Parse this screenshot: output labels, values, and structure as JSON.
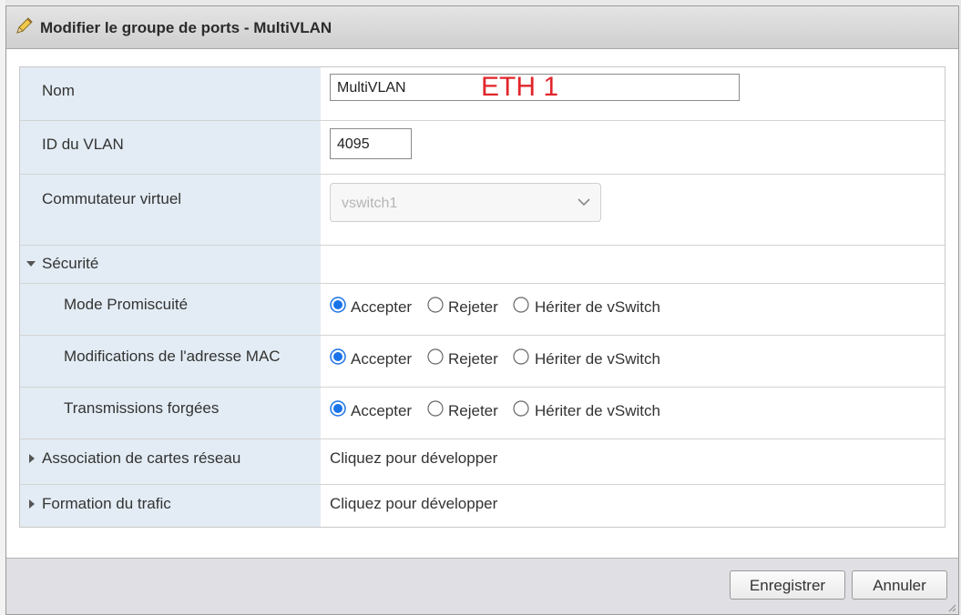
{
  "dialog": {
    "title": "Modifier le groupe de ports - MultiVLAN",
    "title_icon": "pencil-icon"
  },
  "fields": {
    "name_label": "Nom",
    "name_value": "MultiVLAN",
    "annotation": "ETH 1",
    "vlan_label": "ID du VLAN",
    "vlan_value": "4095",
    "vswitch_label": "Commutateur virtuel",
    "vswitch_value": "vswitch1"
  },
  "security": {
    "label": "Sécurité",
    "options": [
      "Accepter",
      "Rejeter",
      "Hériter de vSwitch"
    ],
    "rows": [
      {
        "label": "Mode Promiscuité",
        "selected": "Accepter"
      },
      {
        "label": "Modifications de l'adresse MAC",
        "selected": "Accepter"
      },
      {
        "label": "Transmissions forgées",
        "selected": "Accepter"
      }
    ]
  },
  "collapsed": [
    {
      "label": "Association de cartes réseau",
      "value": "Cliquez pour développer"
    },
    {
      "label": "Formation du trafic",
      "value": "Cliquez pour développer"
    }
  ],
  "footer": {
    "save_label": "Enregistrer",
    "cancel_label": "Annuler"
  },
  "colors": {
    "label_bg": "#e3ecf4",
    "radio_selected": "#1a73e8",
    "annotation": "#e0262b"
  }
}
